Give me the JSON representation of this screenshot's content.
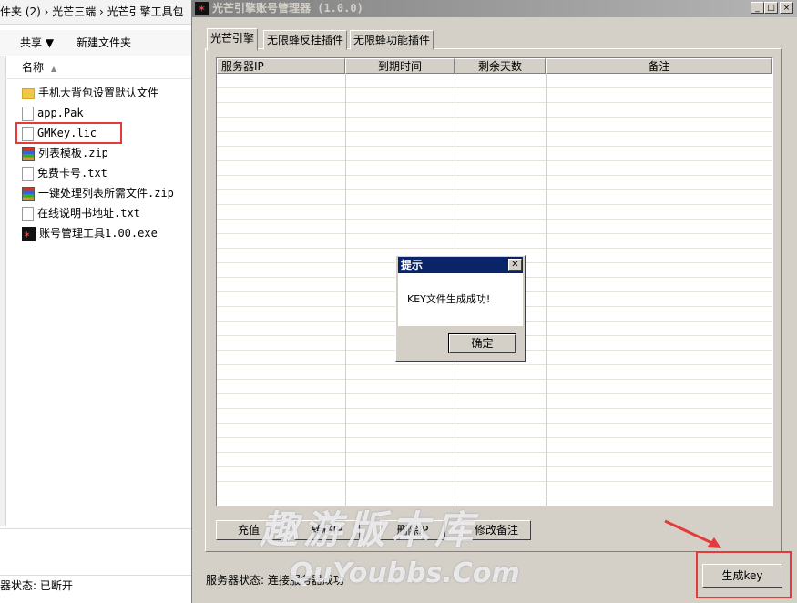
{
  "explorer": {
    "address_text": "件夹 (2) › 光芒三端 › 光芒引擎工具包",
    "toolbar": {
      "share_label": "共享 ▼",
      "new_folder_label": "新建文件夹"
    },
    "column_name": "名称",
    "files": [
      {
        "name": "手机大背包设置默认文件",
        "icon": "folder-icon"
      },
      {
        "name": "app.Pak",
        "icon": "file-icon"
      },
      {
        "name": "GMKey.lic",
        "icon": "file-icon"
      },
      {
        "name": "列表模板.zip",
        "icon": "archive-icon"
      },
      {
        "name": "免费卡号.txt",
        "icon": "text-file-icon"
      },
      {
        "name": "一键处理列表所需文件.zip",
        "icon": "archive-icon"
      },
      {
        "name": "在线说明书地址.txt",
        "icon": "text-file-icon"
      },
      {
        "name": "账号管理工具1.00.exe",
        "icon": "app-icon"
      }
    ],
    "status_text": "器状态: 已断开"
  },
  "app": {
    "title": "光芒引擎账号管理器 (1.0.0)",
    "window_buttons": {
      "minimize": "_",
      "maximize": "□",
      "close": "×"
    },
    "tabs": [
      "光芒引擎",
      "无限蜂反挂插件",
      "无限蜂功能插件"
    ],
    "columns": [
      "服务器IP",
      "到期时间",
      "剩余天数",
      "备注"
    ],
    "buttons": [
      "充值",
      "转移IP",
      "删除IP",
      "修改备注"
    ],
    "status_text": "服务器状态: 连接服务器成功",
    "generate_label": "生成key"
  },
  "dialog": {
    "title": "提示",
    "message": "KEY文件生成成功!",
    "ok_label": "确定"
  },
  "watermark": {
    "line1": "趣游版本库",
    "line2": "QuYoubbs.Com"
  },
  "colors": {
    "highlight": "#e33b3b",
    "dialog_title": "#0a246a",
    "window_face": "#d4d0c8"
  }
}
